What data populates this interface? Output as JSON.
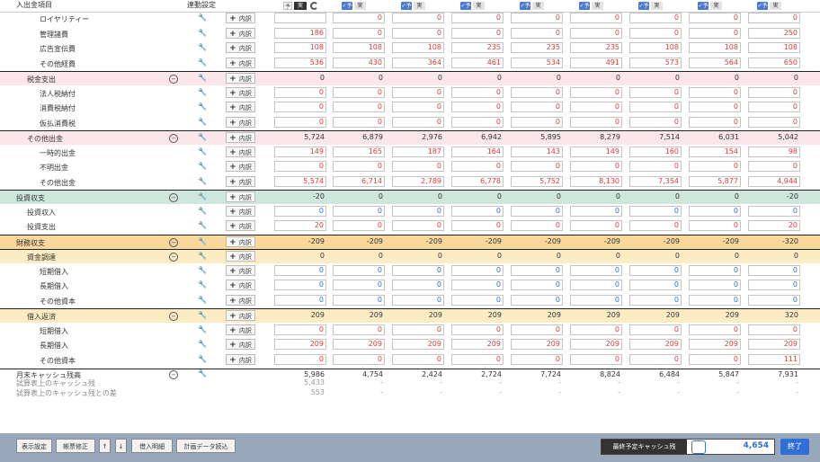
{
  "header": {
    "col_item": "入出金項目",
    "col_settings": "連動設定",
    "ytd_check": "予",
    "ytd_label": "実",
    "col_check": "✓予",
    "col_label": "実"
  },
  "naiyaku_label": "内訳",
  "rows": [
    {
      "label": "ロイヤリティー",
      "indent": 2,
      "type": "plain",
      "values": [
        "",
        "0",
        "0",
        "0",
        "0",
        "0",
        "0",
        "0",
        "0"
      ],
      "color": "red",
      "boxed": true
    },
    {
      "label": "管理諸費",
      "indent": 2,
      "type": "plain",
      "values": [
        "186",
        "0",
        "0",
        "0",
        "0",
        "0",
        "0",
        "0",
        "250"
      ],
      "color": "red",
      "boxed": true
    },
    {
      "label": "広告宣伝費",
      "indent": 2,
      "type": "plain",
      "values": [
        "108",
        "108",
        "108",
        "235",
        "235",
        "235",
        "108",
        "108",
        "108"
      ],
      "color": "red",
      "boxed": true
    },
    {
      "label": "その他経費",
      "indent": 2,
      "type": "plain",
      "values": [
        "536",
        "430",
        "364",
        "461",
        "534",
        "491",
        "573",
        "564",
        "650"
      ],
      "color": "red",
      "boxed": true
    },
    {
      "label": "税金支出",
      "indent": 1,
      "type": "pink",
      "values": [
        "0",
        "0",
        "0",
        "0",
        "0",
        "0",
        "0",
        "0",
        "0"
      ],
      "color": "dark",
      "boxed": false,
      "collapse": true
    },
    {
      "label": "法人税納付",
      "indent": 2,
      "type": "plain",
      "values": [
        "0",
        "0",
        "0",
        "0",
        "0",
        "0",
        "0",
        "0",
        "0"
      ],
      "color": "red",
      "boxed": true
    },
    {
      "label": "消費税納付",
      "indent": 2,
      "type": "plain",
      "values": [
        "0",
        "0",
        "0",
        "0",
        "0",
        "0",
        "0",
        "0",
        "0"
      ],
      "color": "red",
      "boxed": true
    },
    {
      "label": "仮払消費税",
      "indent": 2,
      "type": "plain",
      "values": [
        "0",
        "0",
        "0",
        "0",
        "0",
        "0",
        "0",
        "0",
        "0"
      ],
      "color": "red",
      "boxed": true
    },
    {
      "label": "その他出金",
      "indent": 1,
      "type": "pink",
      "values": [
        "5,724",
        "6,879",
        "2,976",
        "6,942",
        "5,895",
        "8,279",
        "7,514",
        "6,031",
        "5,042"
      ],
      "color": "dark",
      "boxed": false,
      "collapse": true
    },
    {
      "label": "一時的出金",
      "indent": 2,
      "type": "plain",
      "values": [
        "149",
        "165",
        "187",
        "164",
        "143",
        "149",
        "160",
        "154",
        "98"
      ],
      "color": "red",
      "boxed": true
    },
    {
      "label": "不明出金",
      "indent": 2,
      "type": "plain",
      "values": [
        "0",
        "0",
        "0",
        "0",
        "0",
        "0",
        "0",
        "0",
        "0"
      ],
      "color": "red",
      "boxed": true
    },
    {
      "label": "その他出金",
      "indent": 2,
      "type": "plain",
      "values": [
        "5,574",
        "6,714",
        "2,789",
        "6,778",
        "5,752",
        "8,130",
        "7,354",
        "5,877",
        "4,944"
      ],
      "color": "red",
      "boxed": true
    },
    {
      "label": "投資収支",
      "indent": 0,
      "type": "teal",
      "values": [
        "-20",
        "0",
        "0",
        "0",
        "0",
        "0",
        "0",
        "0",
        "-20"
      ],
      "color": "dark",
      "boxed": false,
      "collapse": true
    },
    {
      "label": "投資収入",
      "indent": 1,
      "type": "plain",
      "values": [
        "0",
        "0",
        "0",
        "0",
        "0",
        "0",
        "0",
        "0",
        "0"
      ],
      "color": "blue",
      "boxed": true
    },
    {
      "label": "投資支出",
      "indent": 1,
      "type": "plain",
      "values": [
        "20",
        "0",
        "0",
        "0",
        "0",
        "0",
        "0",
        "0",
        "20"
      ],
      "color": "red",
      "boxed": true
    },
    {
      "label": "財務収支",
      "indent": 0,
      "type": "orange",
      "values": [
        "-209",
        "-209",
        "-209",
        "-209",
        "-209",
        "-209",
        "-209",
        "-209",
        "-320"
      ],
      "color": "dark",
      "boxed": false,
      "collapse": true
    },
    {
      "label": "資金調達",
      "indent": 1,
      "type": "yellow",
      "values": [
        "0",
        "0",
        "0",
        "0",
        "0",
        "0",
        "0",
        "0",
        "0"
      ],
      "color": "dark",
      "boxed": false,
      "collapse": true
    },
    {
      "label": "短期借入",
      "indent": 2,
      "type": "plain",
      "values": [
        "0",
        "0",
        "0",
        "0",
        "0",
        "0",
        "0",
        "0",
        "0"
      ],
      "color": "blue",
      "boxed": true
    },
    {
      "label": "長期借入",
      "indent": 2,
      "type": "plain",
      "values": [
        "0",
        "0",
        "0",
        "0",
        "0",
        "0",
        "0",
        "0",
        "0"
      ],
      "color": "blue",
      "boxed": true
    },
    {
      "label": "その他資本",
      "indent": 2,
      "type": "plain",
      "values": [
        "0",
        "0",
        "0",
        "0",
        "0",
        "0",
        "0",
        "0",
        "0"
      ],
      "color": "blue",
      "boxed": true
    },
    {
      "label": "借入返済",
      "indent": 1,
      "type": "yellow",
      "values": [
        "209",
        "209",
        "209",
        "209",
        "209",
        "209",
        "209",
        "209",
        "320"
      ],
      "color": "dark",
      "boxed": false,
      "collapse": true
    },
    {
      "label": "短期借入",
      "indent": 2,
      "type": "plain",
      "values": [
        "0",
        "0",
        "0",
        "0",
        "0",
        "0",
        "0",
        "0",
        "0"
      ],
      "color": "red",
      "boxed": true
    },
    {
      "label": "長期借入",
      "indent": 2,
      "type": "plain",
      "values": [
        "209",
        "209",
        "209",
        "209",
        "209",
        "209",
        "209",
        "209",
        "209"
      ],
      "color": "red",
      "boxed": true
    },
    {
      "label": "その他資本",
      "indent": 2,
      "type": "plain",
      "values": [
        "0",
        "0",
        "0",
        "0",
        "0",
        "0",
        "0",
        "0",
        "111"
      ],
      "color": "red",
      "boxed": true
    }
  ],
  "footer_rows": [
    {
      "label": "月末キャッシュ残高",
      "values": [
        "5,986",
        "4,754",
        "2,424",
        "2,724",
        "7,724",
        "8,824",
        "6,484",
        "5,847",
        "7,931"
      ],
      "color": "dark",
      "collapse": true,
      "wrench": true
    },
    {
      "label": "試算表上のキャッシュ残",
      "values": [
        "5,433",
        "-",
        "-",
        "-",
        "-",
        "-",
        "-",
        "-",
        "-"
      ],
      "color": "gray",
      "collapse": false,
      "wrench": false
    },
    {
      "label": "試算表上のキャッシュ残との差",
      "values": [
        "553",
        "-",
        "-",
        "-",
        "-",
        "-",
        "-",
        "-",
        "-"
      ],
      "color": "gray",
      "collapse": false,
      "wrench": false
    }
  ],
  "bottom": {
    "buttons": [
      "表示設定",
      "帳票修正",
      "↑",
      "↓",
      "借入明細",
      "計画データ読込"
    ],
    "cash_label": "最終予定キャッシュ残",
    "cash_value": "4,654",
    "end_label": "終了"
  },
  "colors": {
    "pink": "#fbe6ea",
    "teal": "#cde7dd",
    "orange": "#fad79b",
    "yellow": "#fbecc3",
    "red": "#e03a3a",
    "blue": "#2f6fd6",
    "bar": "#9aa8bc"
  }
}
